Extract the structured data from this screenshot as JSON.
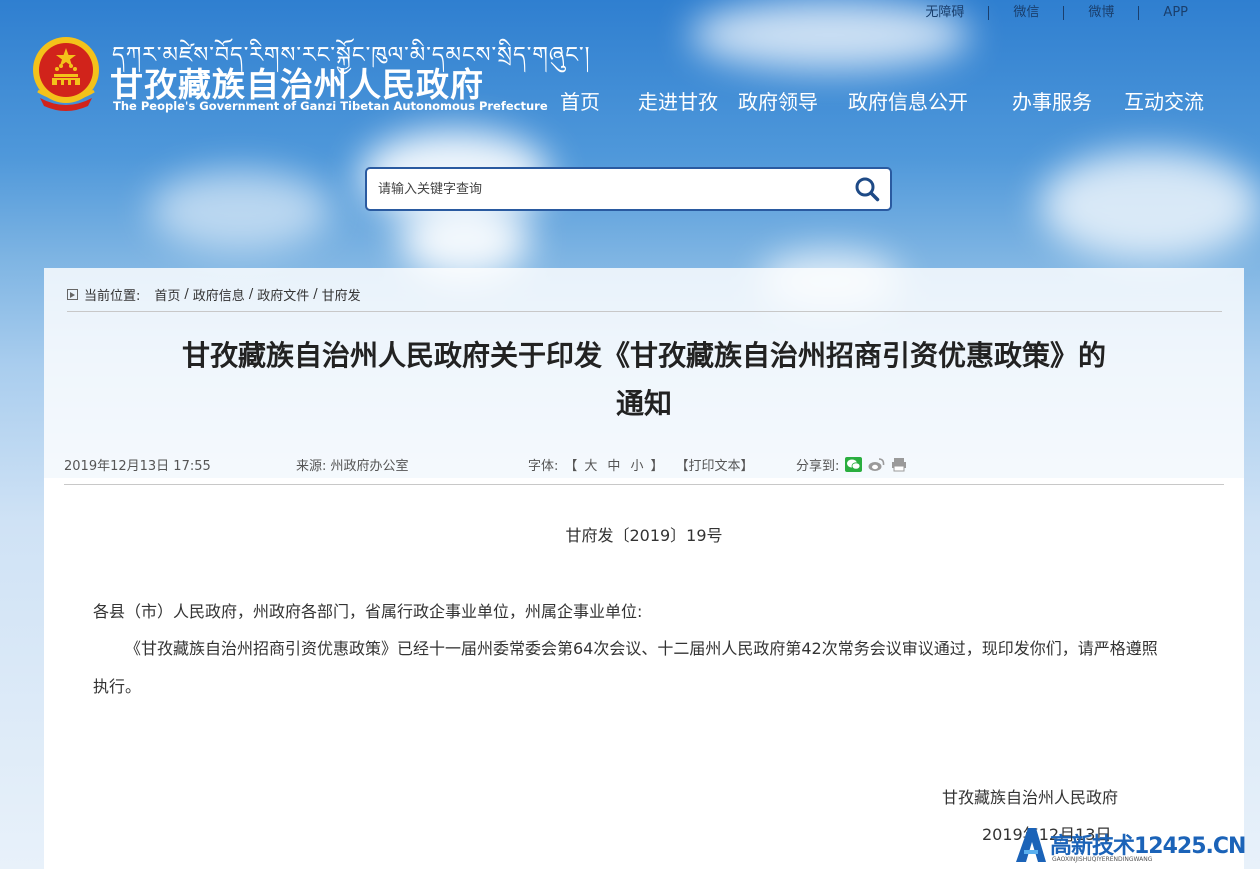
{
  "top_links": [
    "无障碍",
    "微信",
    "微博",
    "APP"
  ],
  "site": {
    "tibetan": "དཀར་མཛེས་བོད་རིགས་རང་སྐྱོང་ཁུལ་མི་དམངས་སྲིད་གཞུང་།",
    "title": "甘孜藏族自治州人民政府",
    "subtitle": "The People's Government of Ganzi Tibetan Autonomous Prefecture"
  },
  "nav": [
    "首页",
    "走进甘孜",
    "政府领导",
    "政府信息公开",
    "办事服务",
    "互动交流"
  ],
  "search": {
    "placeholder": "请输入关键字查询"
  },
  "breadcrumb": {
    "label": "当前位置:",
    "items": [
      "首页",
      "政府信息",
      "政府文件",
      "甘府发"
    ]
  },
  "article": {
    "title_line1": "甘孜藏族自治州人民政府关于印发《甘孜藏族自治州招商引资优惠政策》的",
    "title_line2": "通知",
    "date": "2019年12月13日 17:55",
    "source": "来源: 州政府办公室",
    "font_label": "字体:",
    "font_open": "【",
    "font_sizes": [
      "大",
      "中",
      "小"
    ],
    "font_close": "】",
    "print_label": "【打印文本】",
    "share_label": "分享到:",
    "doc_number": "甘府发〔2019〕19号",
    "addressee": "各县（市）人民政府，州政府各部门，省属行政企事业单位，州属企事业单位:",
    "body": "《甘孜藏族自治州招商引资优惠政策》已经十一届州委常委会第64次会议、十二届州人民政府第42次常务会议审议通过，现印发你们，请严格遵照执行。",
    "signature": "甘孜藏族自治州人民政府",
    "sign_date": "2019年12月13日"
  },
  "watermark": {
    "text": "高新技术12425.CN",
    "sub": "GAOXINJISHUQIYERENDINGWANG"
  },
  "colors": {
    "brand_blue": "#1b63b8",
    "search_border": "#2a5aa0",
    "emblem_red": "#d1231b",
    "emblem_gold": "#f4c21a",
    "wechat_green": "#2aae3f"
  }
}
